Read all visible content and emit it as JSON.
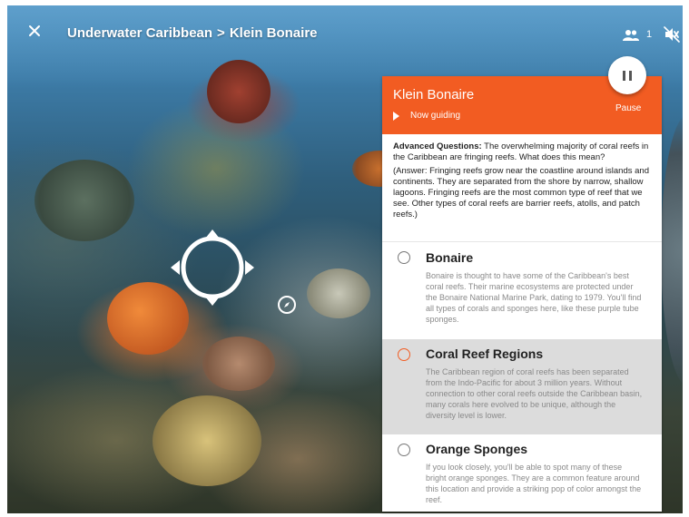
{
  "header": {
    "close_icon": "close-icon",
    "breadcrumb_parent": "Underwater Caribbean",
    "breadcrumb_separator": ">",
    "breadcrumb_current": "Klein Bonaire",
    "people_icon": "people-icon",
    "people_count": "1",
    "mute_icon": "volume-off-icon"
  },
  "panel": {
    "title": "Klein Bonaire",
    "status": "Now guiding",
    "pause_label": "Pause",
    "accent_color": "#f25c22",
    "question_label": "Advanced Questions:",
    "question_text": "The overwhelming majority of coral reefs in the Caribbean are fringing reefs. What does this mean?",
    "answer_text": "(Answer: Fringing reefs grow near the coastline around islands and continents. They are separated from the shore by narrow, shallow lagoons. Fringing reefs are the most common type of reef that we see. Other types of coral reefs are barrier reefs, atolls, and patch reefs.)",
    "items": [
      {
        "name": "Bonaire",
        "description": "Bonaire is thought to have some of the Caribbean's best coral reefs. Their marine ecosystems are protected under the Bonaire National Marine Park, dating to 1979. You'll find all types of corals and sponges here, like these purple tube sponges.",
        "selected": false
      },
      {
        "name": "Coral Reef Regions",
        "description": "The Caribbean region of coral reefs has been separated from the Indo-Pacific for about 3 million years. Without connection to other coral reefs outside the Caribbean basin, many corals here evolved to be unique, although the diversity level is lower.",
        "selected": true
      },
      {
        "name": "Orange Sponges",
        "description": "If you look closely, you'll be able to spot many of these bright orange sponges. They are a common feature around this location and provide a striking pop of color amongst the reef.",
        "selected": false
      }
    ]
  }
}
